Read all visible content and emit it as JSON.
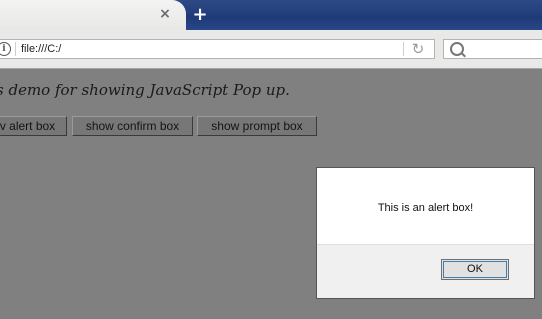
{
  "browser": {
    "tab": {
      "close_glyph": "×"
    },
    "new_tab_glyph": "+",
    "address_bar": {
      "url": "file:///C:/",
      "info_glyph": "i",
      "reload_glyph": "↻"
    },
    "search_bar": {
      "value": ""
    }
  },
  "page": {
    "intro_text": "s demo for showing JavaScript Pop up.",
    "buttons": [
      {
        "label": "v alert box"
      },
      {
        "label": "show confirm box"
      },
      {
        "label": "show prompt box"
      }
    ]
  },
  "dialog": {
    "message": "This is an alert box!",
    "ok_label": "OK"
  },
  "colors": {
    "overlay": "#808080",
    "tabbar": "#1f3a78",
    "dialog_bg": "#f0f0f0"
  }
}
